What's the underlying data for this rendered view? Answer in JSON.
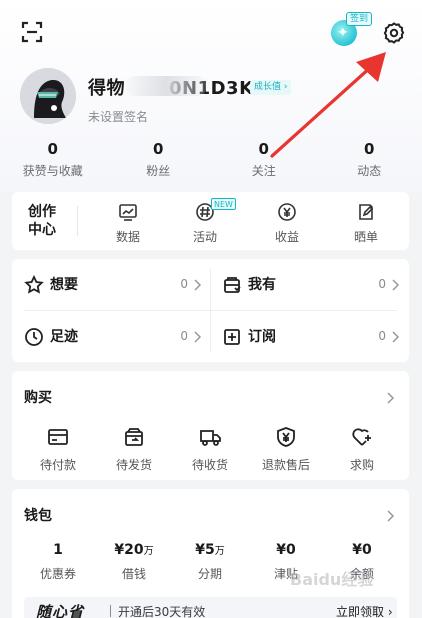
{
  "header": {
    "checkin_badge": "签到",
    "checkin_icon": "sparkle-icon",
    "scan_icon": "scan-icon",
    "settings_icon": "gear-icon"
  },
  "profile": {
    "username": "得物",
    "username_suffix": "0N1D3K7X",
    "growth_label": "成长值 ›",
    "signature": "未设置签名"
  },
  "stats": [
    {
      "value": "0",
      "label": "获赞与收藏"
    },
    {
      "value": "0",
      "label": "粉丝"
    },
    {
      "value": "0",
      "label": "关注"
    },
    {
      "value": "0",
      "label": "动态"
    }
  ],
  "creator": {
    "title": "创作中心",
    "items": [
      {
        "label": "数据",
        "icon": "chart-icon"
      },
      {
        "label": "活动",
        "icon": "hashtag-icon",
        "badge": "NEW"
      },
      {
        "label": "收益",
        "icon": "yen-icon"
      },
      {
        "label": "晒单",
        "icon": "edit-icon"
      }
    ]
  },
  "wants": [
    {
      "label": "想要",
      "count": "0",
      "icon": "star-icon"
    },
    {
      "label": "我有",
      "count": "0",
      "icon": "wardrobe-icon"
    },
    {
      "label": "足迹",
      "count": "0",
      "icon": "clock-icon"
    },
    {
      "label": "订阅",
      "count": "0",
      "icon": "plus-square-icon"
    }
  ],
  "purchase": {
    "title": "购买",
    "items": [
      {
        "label": "待付款",
        "icon": "card-icon"
      },
      {
        "label": "待发货",
        "icon": "box-icon"
      },
      {
        "label": "待收货",
        "icon": "truck-icon"
      },
      {
        "label": "退款售后",
        "icon": "shield-yen-icon"
      },
      {
        "label": "求购",
        "icon": "heart-plus-icon"
      }
    ]
  },
  "wallet": {
    "title": "钱包",
    "items": [
      {
        "value": "1",
        "unit": "",
        "label": "优惠券"
      },
      {
        "value": "¥20",
        "unit": "万",
        "label": "借钱"
      },
      {
        "value": "¥5",
        "unit": "万",
        "label": "分期"
      },
      {
        "value": "¥0",
        "unit": "",
        "label": "津贴"
      },
      {
        "value": "¥0",
        "unit": "",
        "label": "余额"
      }
    ],
    "promo": {
      "logo": "随心省",
      "text": "开通后30天有效",
      "action": "立即领取 ›"
    }
  },
  "watermark": "Baidu经验",
  "colors": {
    "accent": "#13b9c6",
    "arrow": "#e8352f"
  }
}
